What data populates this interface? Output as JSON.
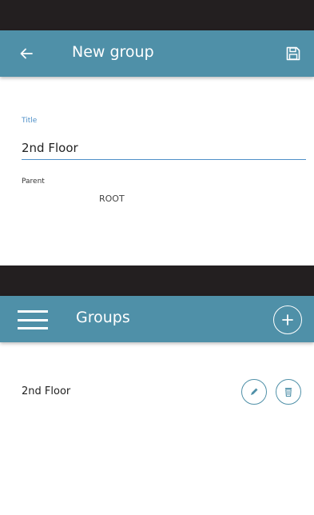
{
  "colors": {
    "status_bar": "#231f20",
    "app_bar": "#4f90a8",
    "accent": "#4f90c8",
    "background": "#ffffff"
  },
  "new_group_screen": {
    "title": "New group",
    "back_icon": "arrow-left-icon",
    "save_icon": "floppy-disk-icon",
    "title_field": {
      "label": "Title",
      "value": "2nd Floor"
    },
    "parent_field": {
      "label": "Parent",
      "value": "ROOT"
    }
  },
  "groups_screen": {
    "title": "Groups",
    "menu_icon": "hamburger-menu-icon",
    "add_icon": "plus-circle-icon",
    "groups": [
      {
        "name": "2nd Floor",
        "edit_icon": "pencil-icon",
        "delete_icon": "trash-icon"
      }
    ]
  }
}
